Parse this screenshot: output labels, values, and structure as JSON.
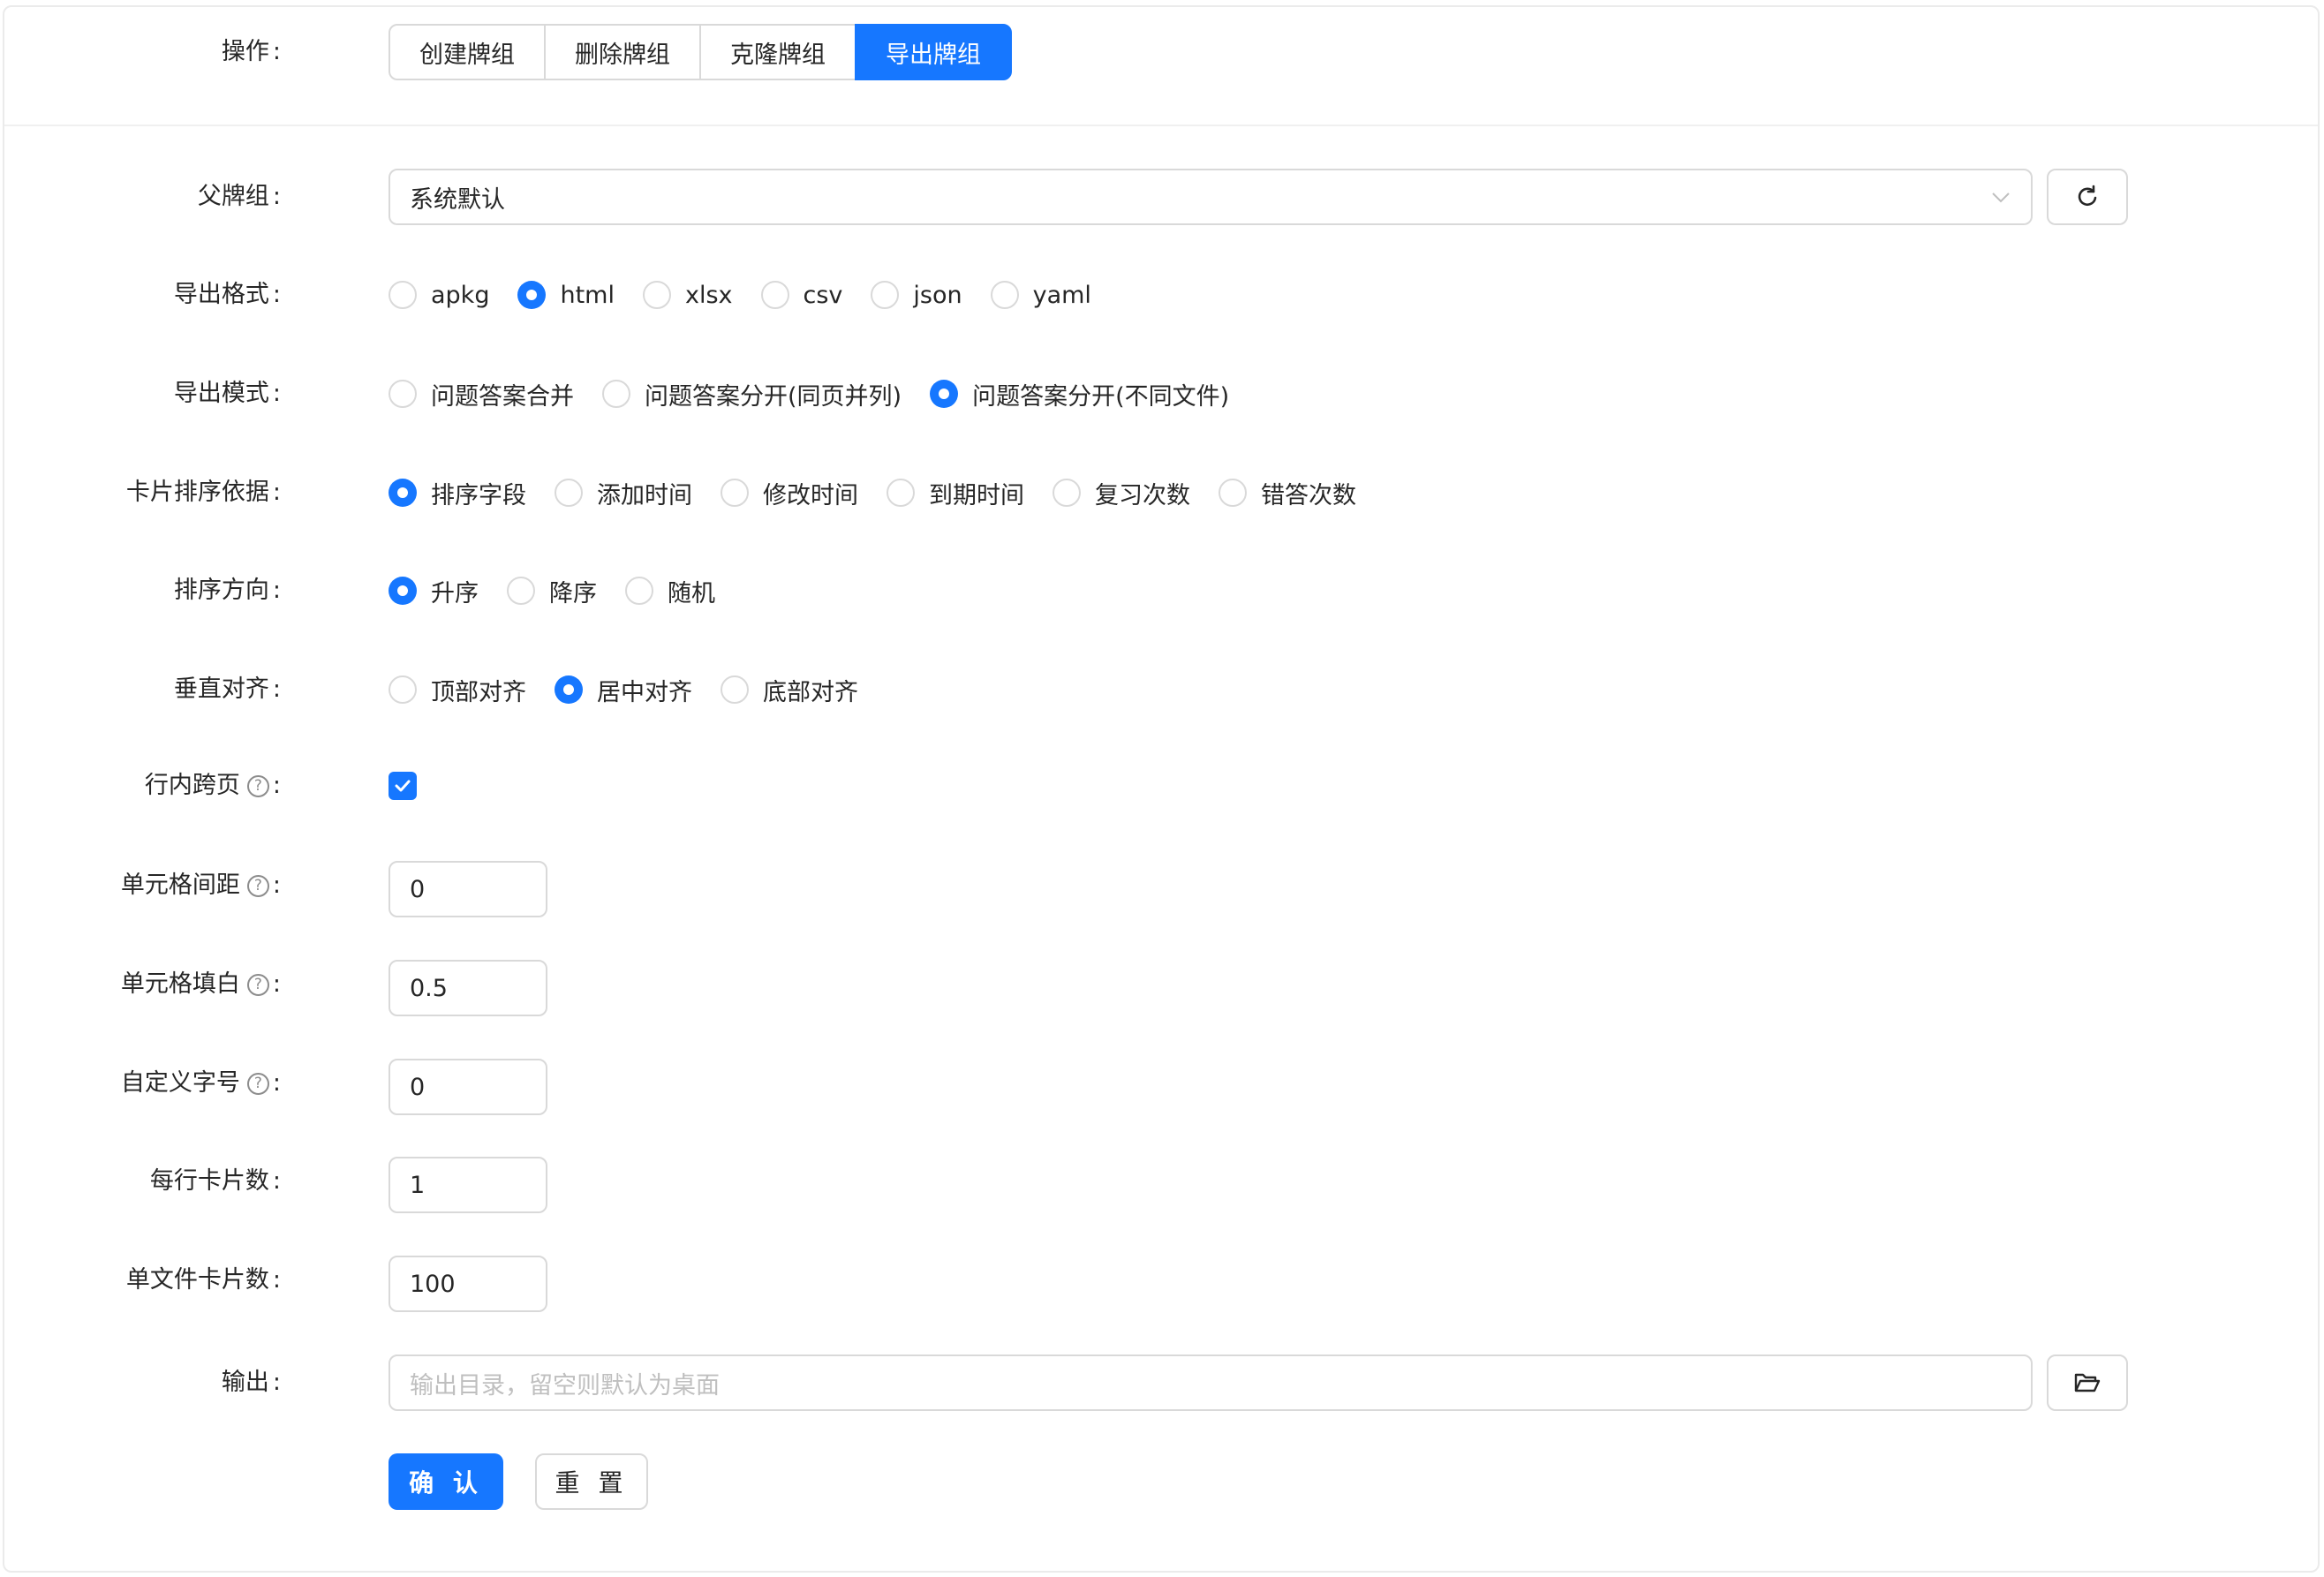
{
  "operation": {
    "label": "操作",
    "buttons": [
      "创建牌组",
      "删除牌组",
      "克隆牌组",
      "导出牌组"
    ],
    "active_index": 3
  },
  "parent_deck": {
    "label": "父牌组",
    "value": "系统默认"
  },
  "export_format": {
    "label": "导出格式",
    "options": [
      "apkg",
      "html",
      "xlsx",
      "csv",
      "json",
      "yaml"
    ],
    "selected": "html"
  },
  "export_mode": {
    "label": "导出模式",
    "options": [
      "问题答案合并",
      "问题答案分开(同页并列)",
      "问题答案分开(不同文件)"
    ],
    "selected": "问题答案分开(不同文件)"
  },
  "sort_basis": {
    "label": "卡片排序依据",
    "options": [
      "排序字段",
      "添加时间",
      "修改时间",
      "到期时间",
      "复习次数",
      "错答次数"
    ],
    "selected": "排序字段"
  },
  "sort_direction": {
    "label": "排序方向",
    "options": [
      "升序",
      "降序",
      "随机"
    ],
    "selected": "升序"
  },
  "vertical_align": {
    "label": "垂直对齐",
    "options": [
      "顶部对齐",
      "居中对齐",
      "底部对齐"
    ],
    "selected": "居中对齐"
  },
  "inline_page_break": {
    "label": "行内跨页",
    "checked": true
  },
  "cell_spacing": {
    "label": "单元格间距",
    "value": "0"
  },
  "cell_padding": {
    "label": "单元格填白",
    "value": "0.5"
  },
  "custom_font_size": {
    "label": "自定义字号",
    "value": "0"
  },
  "cards_per_row": {
    "label": "每行卡片数",
    "value": "1"
  },
  "cards_per_file": {
    "label": "单文件卡片数",
    "value": "100"
  },
  "output": {
    "label": "输出",
    "placeholder": "输出目录，留空则默认为桌面",
    "value": ""
  },
  "actions": {
    "confirm": "确 认",
    "reset": "重 置"
  },
  "colors": {
    "accent": "#1677ff",
    "border": "#d9d9d9",
    "text": "#262626",
    "placeholder": "#bfbfbf"
  },
  "icons": {
    "help": "question-circle-icon",
    "refresh": "refresh-icon",
    "folder": "folder-open-icon",
    "chevron": "chevron-down-icon",
    "check": "check-icon"
  }
}
